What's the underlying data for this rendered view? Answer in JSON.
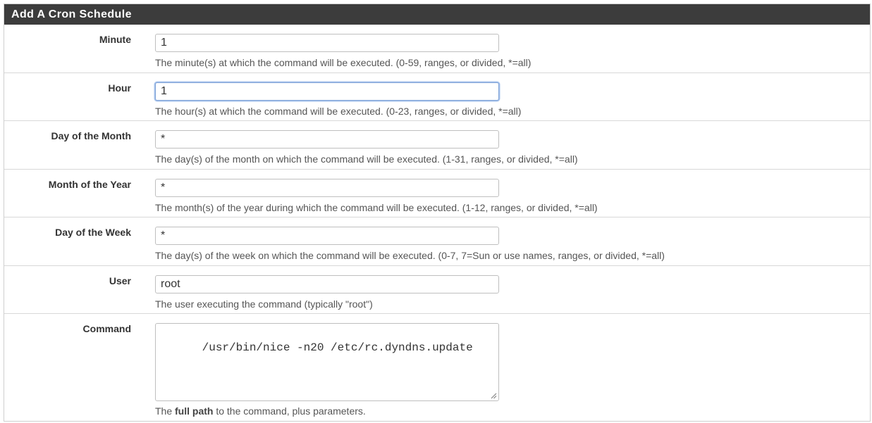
{
  "panel": {
    "title": "Add A Cron Schedule"
  },
  "fields": {
    "minute": {
      "label": "Minute",
      "value": "1",
      "help": "The minute(s) at which the command will be executed. (0-59, ranges, or divided, *=all)"
    },
    "hour": {
      "label": "Hour",
      "value": "1",
      "help": "The hour(s) at which the command will be executed. (0-23, ranges, or divided, *=all)"
    },
    "mday": {
      "label": "Day of the Month",
      "value": "*",
      "help": "The day(s) of the month on which the command will be executed. (1-31, ranges, or divided, *=all)"
    },
    "month": {
      "label": "Month of the Year",
      "value": "*",
      "help": "The month(s) of the year during which the command will be executed. (1-12, ranges, or divided, *=all)"
    },
    "wday": {
      "label": "Day of the Week",
      "value": "*",
      "help": "The day(s) of the week on which the command will be executed. (0-7, 7=Sun or use names, ranges, or divided, *=all)"
    },
    "user": {
      "label": "User",
      "value": "root",
      "help": "The user executing the command (typically \"root\")"
    },
    "command": {
      "label": "Command",
      "value": "/usr/bin/nice -n20 /etc/rc.dyndns.update",
      "help_prefix": "The",
      "help_bold": "full path",
      "help_suffix": "to the command, plus parameters."
    }
  },
  "state": {
    "focused_field": "hour"
  },
  "colors": {
    "header_bg": "#3c3c3c",
    "focus_border": "#7ea2d6"
  }
}
